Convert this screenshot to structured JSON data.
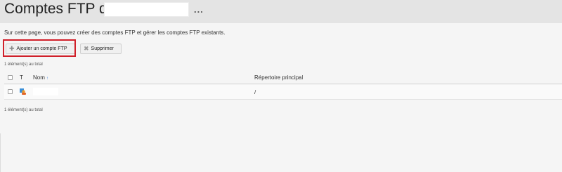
{
  "header": {
    "title": "Comptes FTP de",
    "more_label": "..."
  },
  "description": "Sur cette page, vous pouvez créer des comptes FTP et gérer les comptes FTP existants.",
  "toolbar": {
    "add_label": "Ajouter un compte FTP",
    "add_icon": "plus-icon",
    "delete_label": "Supprimer",
    "delete_icon": "x-icon",
    "highlight_color": "#d0202a"
  },
  "table": {
    "total_top": "1 élément(s) au total",
    "total_bottom": "1 élément(s) au total",
    "columns": {
      "type": "T",
      "name": "Nom",
      "sort_indicator": "↑",
      "directory": "Répertoire principal"
    },
    "rows": [
      {
        "type_icon": "ftp-user-icon",
        "name": "",
        "directory": "/"
      }
    ]
  }
}
